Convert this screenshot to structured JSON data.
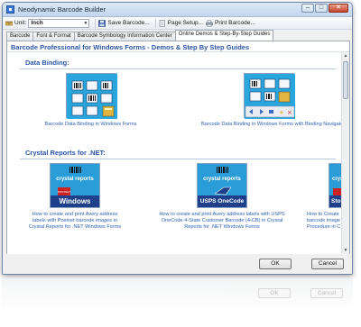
{
  "window": {
    "title": "Neodynamic Barcode Builder"
  },
  "toolbar": {
    "unit_label": "Unit:",
    "unit_value": "Inch",
    "save_label": "Save Barcode...",
    "page_setup_label": "Page Setup...",
    "print_label": "Print Barcode..."
  },
  "tabs": [
    {
      "label": "Barcode"
    },
    {
      "label": "Font & Format"
    },
    {
      "label": "Barcode Symbology Information Center"
    },
    {
      "label": "Online Demos & Step-By-Step Guides"
    }
  ],
  "panel": {
    "header": "Barcode Professional for Windows Forms - Demos & Step By Step Guides",
    "sections": [
      {
        "title": "Data Binding:",
        "items": [
          {
            "caption": "Barcode Data Binding in Windows Forms"
          },
          {
            "caption": "Barcode Data Binding in Windows Forms with Binding Navigator - Vi"
          }
        ]
      },
      {
        "title": "Crystal Reports for .NET:",
        "items": [
          {
            "caption": "How to create and print Avery address labels with Postnet barcode images in Crystal Reports for .NET Windows Forms",
            "logo": "crystal reports",
            "footer": "Windows",
            "badge": "POSTNET"
          },
          {
            "caption": "How to create and print Avery address labels with USPS OneCode 4-State Customer Barcode (4-CB) in Crystal Reports for .NET Windows Forms",
            "logo": "crystal reports",
            "footer": "USPS OneCode"
          },
          {
            "caption": "How to Create barcode image Procedure in C",
            "logo": "crystal",
            "footer": "Stored"
          }
        ]
      }
    ]
  },
  "buttons": {
    "ok": "OK",
    "cancel": "Cancel"
  },
  "colors": {
    "accent": "#2b56a6",
    "link": "#2b5fb4",
    "thumb_blue": "#2aa6df"
  }
}
